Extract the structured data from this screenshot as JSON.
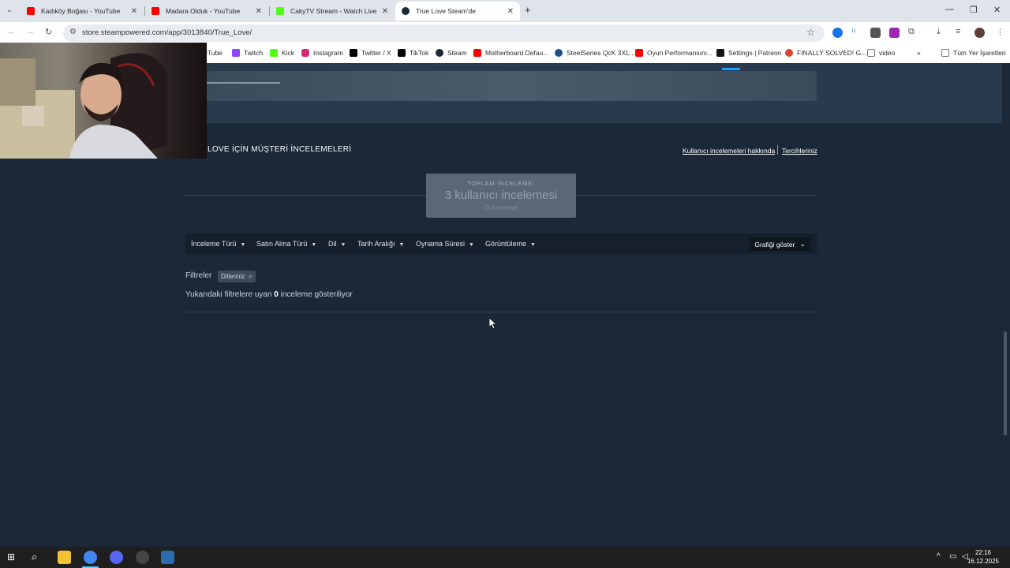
{
  "browser": {
    "tabs": [
      {
        "title": "Kadıköy Boğası - YouTube",
        "color": "#ff0000"
      },
      {
        "title": "Madara Olduk - YouTube",
        "color": "#ff0000"
      },
      {
        "title": "CakyTV Stream - Watch Live on",
        "color": "#53fc18"
      },
      {
        "title": "True Love Steam'de",
        "color": "#1b2838"
      }
    ],
    "new_tab_label": "+",
    "url": "store.steampowered.com/app/3013840/True_Love/",
    "bookmarks": [
      {
        "label": "uTube",
        "color": "#ff0000"
      },
      {
        "label": "Twitch",
        "color": "#9146ff"
      },
      {
        "label": "Kick",
        "color": "#53fc18"
      },
      {
        "label": "Instagram",
        "color": "#d62976"
      },
      {
        "label": "Twitter / X",
        "color": "#000000"
      },
      {
        "label": "TikTok",
        "color": "#000000"
      },
      {
        "label": "Steam",
        "color": "#1b2838"
      },
      {
        "label": "Motherboard Defau...",
        "color": "#ff0000"
      },
      {
        "label": "SteelSeries QcK 3XL...",
        "color": "#1e4f8f"
      },
      {
        "label": "Oyun Performansını...",
        "color": "#ff0000"
      },
      {
        "label": "Settings | Patreon",
        "color": "#141414"
      },
      {
        "label": "FINALLY SOLVED! G...",
        "color": "#e0442e"
      },
      {
        "label": "video",
        "color": "#777777"
      }
    ],
    "more_label": "»",
    "all_bookmarks": "Tüm Yer İşaretleri"
  },
  "steam": {
    "reviews_heading": "LOVE İÇİN MÜŞTERİ İNCELEMELERİ",
    "about_reviews_link": "Kullanıcı incelemeleri hakkında",
    "preferences_link": "Tercihleriniz",
    "total_label": "TOPLAM İNCELEME:",
    "total_value": "3 kullanıcı incelemesi",
    "total_sub": "(3 inceleme)",
    "filters": [
      "İnceleme Türü",
      "Satın Alma Türü",
      "Dil",
      "Tarih Aralığı",
      "Oynama Süresi",
      "Görüntüleme"
    ],
    "graph_button": "Grafiği göster",
    "filters_label": "Filtreler",
    "active_filter": "Dilleriniz",
    "result_prefix": "Yukarıdaki filtrelere uyan",
    "result_count": "0",
    "result_suffix": "inceleme gösteriliyor"
  },
  "taskbar": {
    "time": "22:16",
    "date": "16.12.2025"
  }
}
